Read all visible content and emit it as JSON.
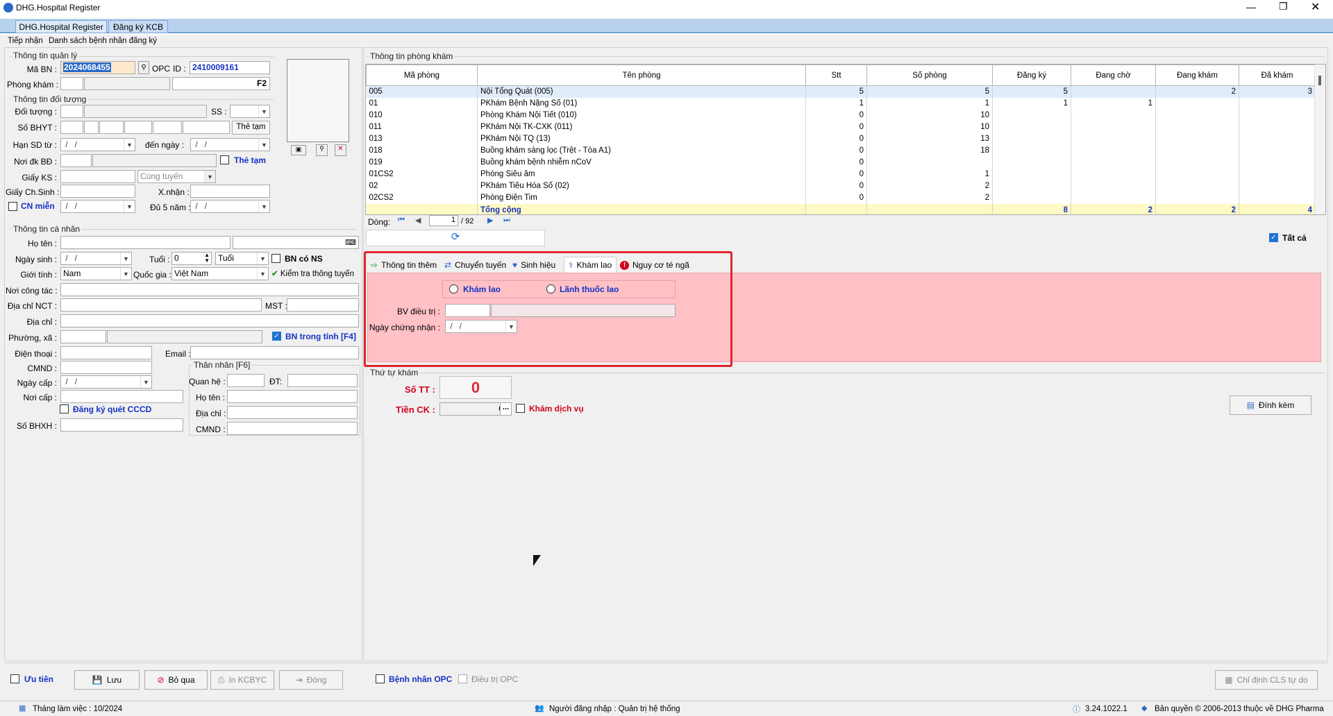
{
  "window": {
    "title": "DHG.Hospital Register"
  },
  "doc_tabs": [
    "DHG.Hospital Register",
    "Đăng ký KCB"
  ],
  "sub_tabs": [
    "Tiếp nhận",
    "Danh sách bệnh nhân đăng ký"
  ],
  "qly": {
    "group": "Thông tin quản lý",
    "ma_bn_label": "Mã BN :",
    "ma_bn": "2024068455",
    "opc": "OPC",
    "id_label": "ID :",
    "id_value": "2410009161",
    "phong_kham_label": "Phòng khám :",
    "f2": "F2"
  },
  "dt": {
    "group": "Thông tin đối tượng",
    "doi_tuong": "Đối tượng :",
    "ss": "SS :",
    "so_bhyt": "Số BHYT :",
    "the_tam_btn": "Thẻ tạm",
    "han_sd": "Hạn SD từ :",
    "date_empty": " /   / ",
    "den_ngay": "đến  ngày :",
    "noi_dk": "Nơi đk BĐ :",
    "the_tam_chk": "Thẻ tạm",
    "giay_ks": "Giấy KS :",
    "cung_tuyen": "Cùng tuyến",
    "giay_chsinh": "Giấy Ch.Sinh :",
    "xnhan": "X.nhận :",
    "cn_mien": "CN miễn",
    "du5nam": "Đủ 5 năm :"
  },
  "cn": {
    "group": "Thông tin cá nhân",
    "ho_ten": "Họ tên :",
    "ngay_sinh": "Ngày sinh :",
    "tuoi": "Tuổi :",
    "tuoi_val": "0",
    "tuoi_unit": "Tuổi",
    "bn_co_ns": "BN có NS",
    "gioi_tinh": "Giới tính :",
    "gioi_tinh_val": "Nam",
    "quoc_gia": "Quốc gia :",
    "quoc_gia_val": "Việt Nam",
    "kiem_tra": "Kiểm tra thông tuyến",
    "noi_cong_tac": "Nơi công tác :",
    "dia_chi_nct": "Địa chỉ  NCT :",
    "mst": "MST :",
    "dia_chi": "Địa chỉ :",
    "phuong_xa": "Phường, xã :",
    "bn_trong_tinh": "BN trong tỉnh [F4]",
    "dien_thoai": "Điện thoại :",
    "email": "Email :",
    "cmnd": "CMND :",
    "than_nhan": "Thân nhân [F6]",
    "ngay_cap": "Ngày cấp :",
    "quan_he": "Quan hệ :",
    "dt": "ĐT:",
    "noi_cap": "Nơi cấp :",
    "tn_ho_ten": "Họ tên :",
    "dk_cccd": "Đăng ký quét CCCD",
    "tn_dia_chi": "Địa chỉ :",
    "so_bhxh": "Số BHXH :",
    "tn_cmnd": "CMND :"
  },
  "pk": {
    "group": "Thông tin phòng khám",
    "headers": [
      "Mã phòng",
      "Tên phòng",
      "Stt",
      "Số phòng",
      "Đăng ký",
      "Đang chờ",
      "Đang khám",
      "Đã khám"
    ],
    "rows": [
      [
        "005",
        "Nội Tổng Quát (005)",
        "5",
        "5",
        "5",
        "",
        "2",
        "3"
      ],
      [
        "01",
        "PKhám Bệnh Nặng Số (01)",
        "1",
        "1",
        "1",
        "1",
        "",
        ""
      ],
      [
        "010",
        "Phòng Khám Nội Tiết (010)",
        "0",
        "10",
        "",
        "",
        "",
        ""
      ],
      [
        "011",
        "PKhám Nội TK-CXK (011)",
        "0",
        "10",
        "",
        "",
        "",
        ""
      ],
      [
        "013",
        "PKhám Nội TQ (13)",
        "0",
        "13",
        "",
        "",
        "",
        ""
      ],
      [
        "018",
        "Buồng khám sàng lọc (Trệt - Tòa A1)",
        "0",
        "18",
        "",
        "",
        "",
        ""
      ],
      [
        "019",
        "Buồng khám bệnh nhiễm nCoV",
        "0",
        "",
        "",
        "",
        "",
        ""
      ],
      [
        "01CS2",
        "Phòng Siêu âm",
        "0",
        "1",
        "",
        "",
        "",
        ""
      ],
      [
        "02",
        "PKhám Tiêu Hóa Số (02)",
        "0",
        "2",
        "",
        "",
        "",
        ""
      ],
      [
        "02CS2",
        "Phòng Điện Tim",
        "0",
        "2",
        "",
        "",
        "",
        ""
      ]
    ],
    "total": [
      "",
      "Tổng cộng",
      "",
      "",
      "8",
      "2",
      "2",
      "4"
    ],
    "dong": "Dòng:",
    "page": "1",
    "pages": "/ 92",
    "tat_ca": "Tất cả"
  },
  "detail_tabs": [
    "Thông tin thêm",
    "Chuyển tuyến",
    "Sinh hiệu",
    "Khám lao",
    "Nguy cơ té ngã"
  ],
  "lao": {
    "kham_lao": "Khám lao",
    "lanh_thuoc": "Lãnh thuốc lao",
    "bv_dieu_tri": "BV điều trị :",
    "ngay_cn": "Ngày chứng nhận :"
  },
  "ttk": {
    "group": "Thứ tự khám",
    "so_tt": "Số TT :",
    "so_tt_val": "0",
    "tien_ck": "Tiền CK :",
    "tien_ck_val": "0",
    "kham_dv": "Khám dịch vụ",
    "dinh_kem": "Đính kèm"
  },
  "bottom": {
    "uu_tien": "Ưu tiên",
    "luu": "Lưu",
    "bo_qua": "Bỏ qua",
    "in_kcbyc": "In KCBYC",
    "dong": "Đóng",
    "bn_opc": "Bệnh nhân OPC",
    "dieu_tri_opc": "Điều trị OPC",
    "chi_dinh": "Chỉ định CLS tự do"
  },
  "status": {
    "thang": "Tháng làm việc : 10/2024",
    "nguoi_dn": "Người đăng nhập : Quản trị hệ thống",
    "version": "3.24.1022.1",
    "ban_quyen": "Bản quyền © 2006-2013 thuộc về DHG Pharma"
  }
}
